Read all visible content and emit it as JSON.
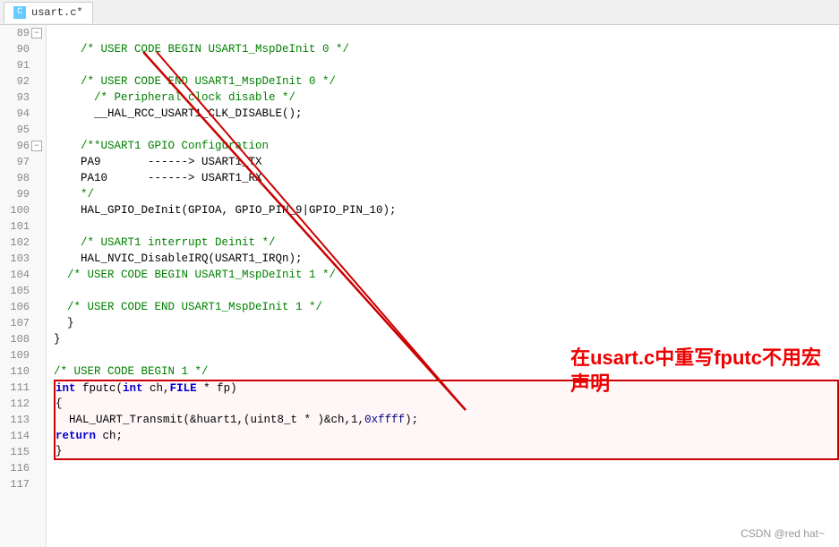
{
  "tab": {
    "icon": "C",
    "label": "usart.c*"
  },
  "lines": [
    {
      "num": 89,
      "fold": true,
      "code": ""
    },
    {
      "num": 90,
      "fold": false,
      "code": "    /* USER CODE BEGIN USART1_MspDeInit 0 */"
    },
    {
      "num": 91,
      "fold": false,
      "code": ""
    },
    {
      "num": 92,
      "fold": false,
      "code": "    /* USER CODE END USART1_MspDeInit 0 */"
    },
    {
      "num": 93,
      "fold": false,
      "code": "      /* Peripheral clock disable */"
    },
    {
      "num": 94,
      "fold": false,
      "code": "      __HAL_RCC_USART1_CLK_DISABLE();"
    },
    {
      "num": 95,
      "fold": false,
      "code": ""
    },
    {
      "num": 96,
      "fold": true,
      "code": "    /**USART1 GPIO Configuration"
    },
    {
      "num": 97,
      "fold": false,
      "code": "    PA9       ------> USART1_TX"
    },
    {
      "num": 98,
      "fold": false,
      "code": "    PA10      ------> USART1_RX"
    },
    {
      "num": 99,
      "fold": false,
      "code": "    */"
    },
    {
      "num": 100,
      "fold": false,
      "code": "    HAL_GPIO_DeInit(GPIOA, GPIO_PIN_9|GPIO_PIN_10);"
    },
    {
      "num": 101,
      "fold": false,
      "code": ""
    },
    {
      "num": 102,
      "fold": false,
      "code": "    /* USART1 interrupt Deinit */"
    },
    {
      "num": 103,
      "fold": false,
      "code": "    HAL_NVIC_DisableIRQ(USART1_IRQn);"
    },
    {
      "num": 104,
      "fold": false,
      "code": "  /* USER CODE BEGIN USART1_MspDeInit 1 */"
    },
    {
      "num": 105,
      "fold": false,
      "code": ""
    },
    {
      "num": 106,
      "fold": false,
      "code": "  /* USER CODE END USART1_MspDeInit 1 */"
    },
    {
      "num": 107,
      "fold": false,
      "code": "  }"
    },
    {
      "num": 108,
      "fold": false,
      "code": "}"
    },
    {
      "num": 109,
      "fold": false,
      "code": ""
    },
    {
      "num": 110,
      "fold": false,
      "code": "/* USER CODE BEGIN 1 */"
    },
    {
      "num": 111,
      "fold": false,
      "code": "int fputc(int ch,FILE * fp)",
      "highlight": true
    },
    {
      "num": 112,
      "fold": false,
      "code": "{",
      "highlight": true
    },
    {
      "num": 113,
      "fold": false,
      "code": "  HAL_UART_Transmit(&huart1,(uint8_t * )&ch,1,0xffff);",
      "highlight": true
    },
    {
      "num": 114,
      "fold": false,
      "code": "  return ch;",
      "highlight": true
    },
    {
      "num": 115,
      "fold": false,
      "code": "}",
      "highlight": true
    },
    {
      "num": 116,
      "fold": false,
      "code": ""
    },
    {
      "num": 117,
      "fold": false,
      "code": ""
    }
  ],
  "annotation": {
    "line1": "在usart.c中重写fputc不用宏",
    "line2": "声明"
  },
  "watermark": "CSDN @red hat~",
  "colors": {
    "red": "#e00000",
    "comment": "#008000",
    "keyword": "#0000cc",
    "highlight_border": "#cc0000"
  }
}
